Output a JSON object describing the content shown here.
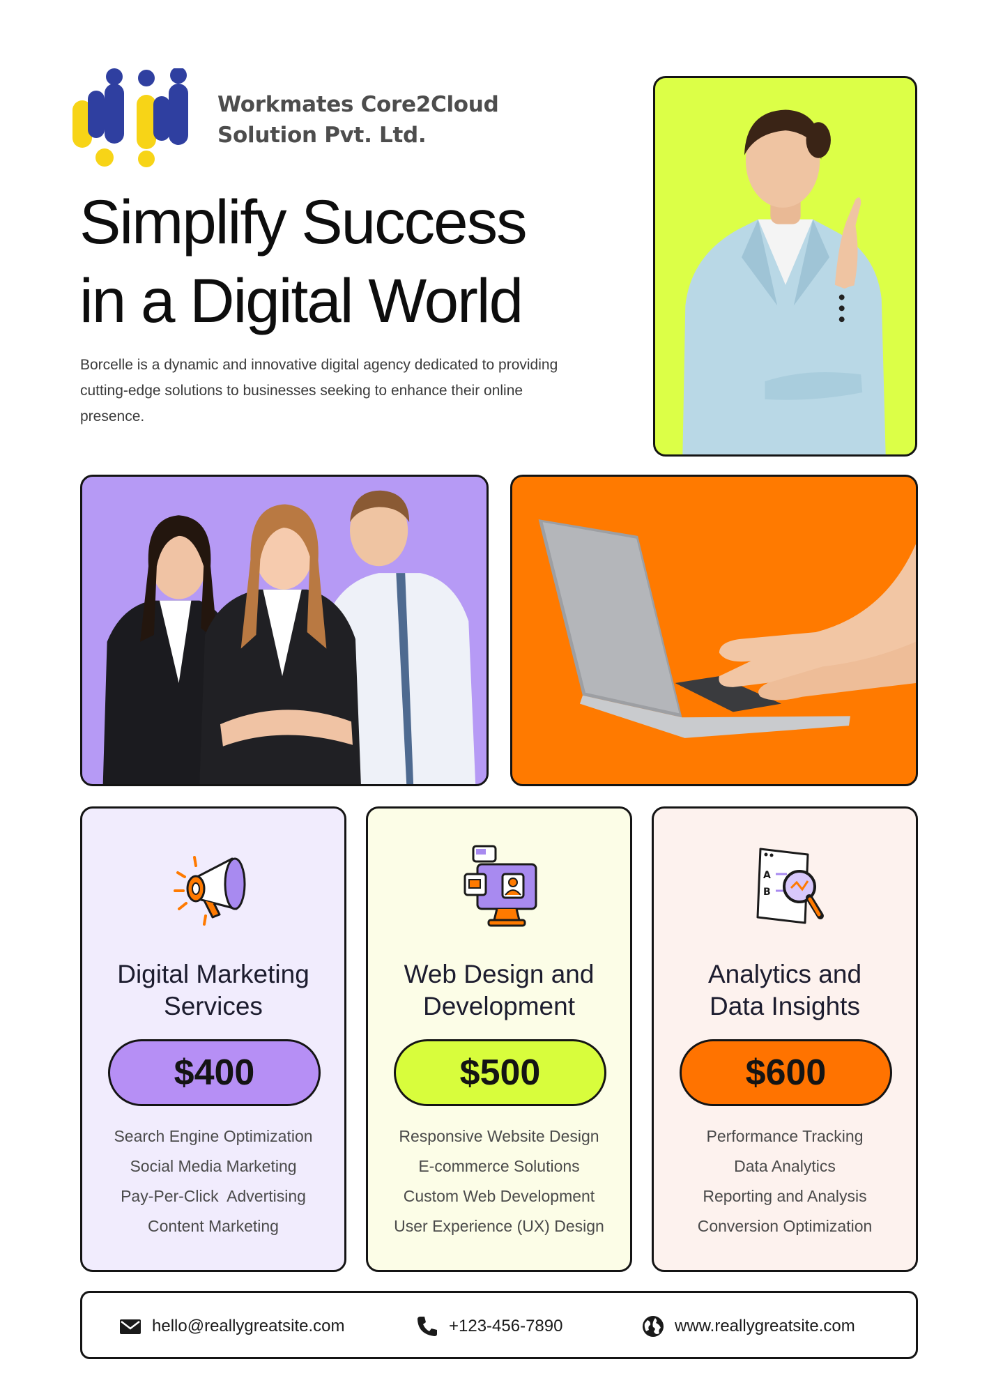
{
  "header": {
    "company_line_1": "Workmates Core2Cloud",
    "company_line_2": "Solution Pvt. Ltd.",
    "logo_colors": {
      "blue": "#2f3fa0",
      "yellow": "#f7d417"
    }
  },
  "hero": {
    "headline_line_1": "Simplify Success",
    "headline_line_2": "in a Digital World",
    "intro": "Borcelle is a dynamic and innovative digital agency dedicated to providing cutting-edge solutions to businesses seeking to enhance their online presence."
  },
  "photos": {
    "woman_bg": "#dcff47",
    "team_bg": "#b69af5",
    "laptop_bg": "#ff7a00"
  },
  "services": [
    {
      "icon": "megaphone-icon",
      "title_line_1": "Digital Marketing",
      "title_line_2": "Services",
      "price": "$400",
      "accent": "#b68ff5",
      "features": [
        "Search Engine Optimization",
        "Social Media Marketing",
        "Pay-Per-Click  Advertising",
        "Content Marketing"
      ]
    },
    {
      "icon": "web-design-icon",
      "title_line_1": "Web Design and",
      "title_line_2": "Development",
      "price": "$500",
      "accent": "#d8fd3c",
      "features": [
        "Responsive Website Design",
        "E-commerce Solutions",
        "Custom Web Development",
        "User Experience (UX) Design"
      ]
    },
    {
      "icon": "analytics-magnifier-icon",
      "title_line_1": "Analytics and",
      "title_line_2": "Data Insights",
      "price": "$600",
      "accent": "#ff7300",
      "features": [
        "Performance Tracking",
        "Data Analytics",
        "Reporting and Analysis",
        "Conversion Optimization"
      ]
    }
  ],
  "contact": {
    "email": "hello@reallygreatsite.com",
    "phone": "+123-456-7890",
    "website": "www.reallygreatsite.com"
  }
}
